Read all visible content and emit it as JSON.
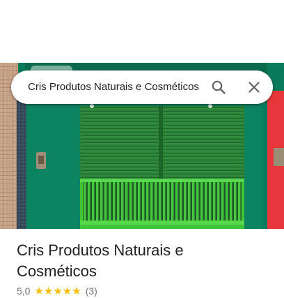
{
  "search": {
    "query": "Cris Produtos Naturais e Cosméticos"
  },
  "place": {
    "title_line1": "Cris Produtos Naturais e",
    "title_line2": "Cosméticos",
    "rating": "5,0",
    "stars": "★★★★★",
    "review_count": "(3)"
  },
  "icons": {
    "search": "search-icon",
    "close": "close-icon"
  },
  "colors": {
    "storefront_green": "#0a7a5c",
    "shutter_green": "#2f8f3a",
    "grille_green": "#3cc83c",
    "star": "#fbbc04"
  }
}
